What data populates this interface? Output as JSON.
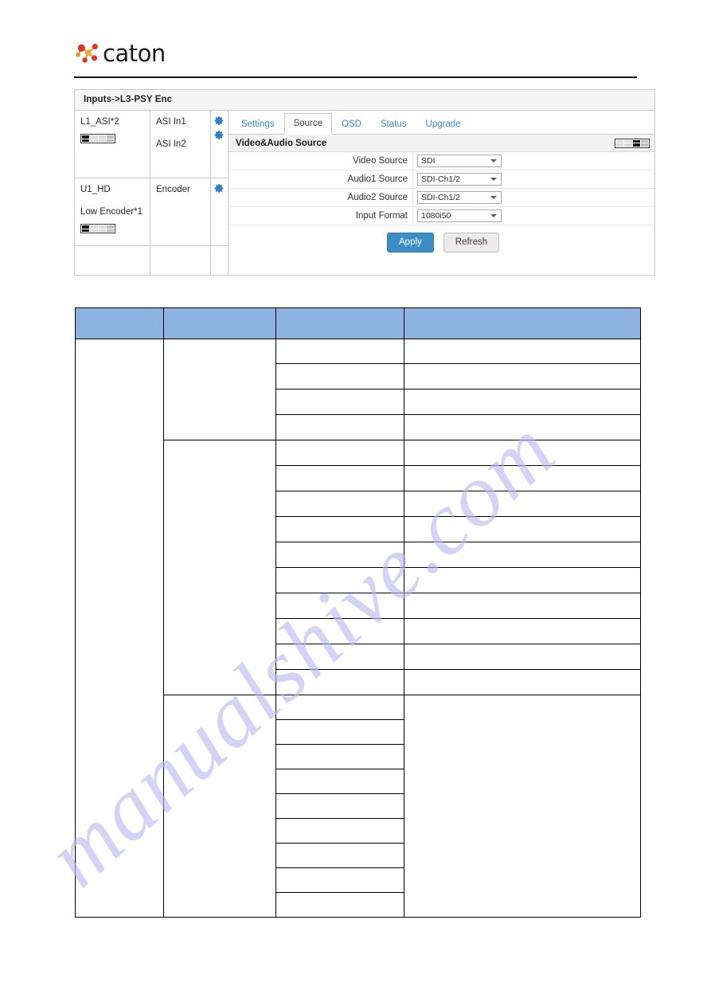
{
  "brand": {
    "logo_text": "caton",
    "logo_icon": "caton-molecule-logo",
    "colors": {
      "logo_red": "#d4342c",
      "logo_orange": "#f0a124",
      "accent_blue": "#3a87c8",
      "table_header_blue": "#8cb3e2"
    }
  },
  "watermark": {
    "text": "manualshive.com"
  },
  "panel": {
    "title": "Inputs->L3-PSY Enc",
    "tree": {
      "rows": [
        {
          "name": "L1_ASI*2",
          "has_indicator": true,
          "sub_items": [
            "ASI In1",
            "ASI In2"
          ],
          "gear_count": 2
        },
        {
          "name": "U1_HD",
          "name_second": "Low Encoder*1",
          "has_indicator": true,
          "sub_items": [
            "Encoder"
          ],
          "gear_count": 1
        }
      ]
    },
    "tabs": [
      {
        "label": "Settings",
        "active": false
      },
      {
        "label": "Source",
        "active": true
      },
      {
        "label": "OSD",
        "active": false
      },
      {
        "label": "Status",
        "active": false
      },
      {
        "label": "Upgrade",
        "active": false
      }
    ],
    "section": {
      "title": "Video&Audio Source",
      "indicator": "led-status-bar",
      "fields": [
        {
          "label": "Video Source",
          "value": "SDI"
        },
        {
          "label": "Audio1 Source",
          "value": "SDI-Ch1/2"
        },
        {
          "label": "Audio2 Source",
          "value": "SDI-Ch1/2"
        },
        {
          "label": "Input Format",
          "value": "1080i50"
        }
      ],
      "buttons": {
        "apply": "Apply",
        "refresh": "Refresh"
      }
    }
  },
  "spec_table": {
    "header": [
      "",
      "",
      "",
      ""
    ],
    "rows": [
      {
        "col1": "",
        "col2": "",
        "col3": "",
        "col4": ""
      },
      {
        "col1": "",
        "col2": "",
        "col3": "",
        "col4": ""
      },
      {
        "col1": "",
        "col2": "",
        "col3": "",
        "col4": ""
      },
      {
        "col1": "",
        "col2": "",
        "col3": "",
        "col4": ""
      },
      {
        "col1": "",
        "col2": "",
        "col3": "",
        "col4": ""
      },
      {
        "col1": "",
        "col2": "",
        "col3": "",
        "col4": ""
      },
      {
        "col1": "",
        "col2": "",
        "col3": "",
        "col4": ""
      },
      {
        "col1": "",
        "col2": "",
        "col3": "",
        "col4": ""
      },
      {
        "col1": "",
        "col2": "",
        "col3": "",
        "col4": ""
      },
      {
        "col1": "",
        "col2": "",
        "col3": "",
        "col4": ""
      },
      {
        "col1": "",
        "col2": "",
        "col3": "",
        "col4": ""
      },
      {
        "col1": "",
        "col2": "",
        "col3": "",
        "col4": ""
      },
      {
        "col1": "",
        "col2": "",
        "col3": "",
        "col4": ""
      },
      {
        "col1": "",
        "col2": "",
        "col3": "",
        "col4": ""
      },
      {
        "col1": "",
        "col2": "",
        "col3": "",
        "col4": ""
      },
      {
        "col1": "",
        "col2": "",
        "col3": "",
        "col4": ""
      },
      {
        "col1": "",
        "col2": "",
        "col3": "",
        "col4": ""
      },
      {
        "col1": "",
        "col2": "",
        "col3": "",
        "col4": ""
      },
      {
        "col1": "",
        "col2": "",
        "col3": "",
        "col4": ""
      },
      {
        "col1": "",
        "col2": "",
        "col3": "",
        "col4": ""
      },
      {
        "col1": "",
        "col2": "",
        "col3": "",
        "col4": ""
      },
      {
        "col1": "",
        "col2": "",
        "col3": "",
        "col4": ""
      },
      {
        "col1": "",
        "col2": "",
        "col3": "",
        "col4": ""
      }
    ]
  }
}
